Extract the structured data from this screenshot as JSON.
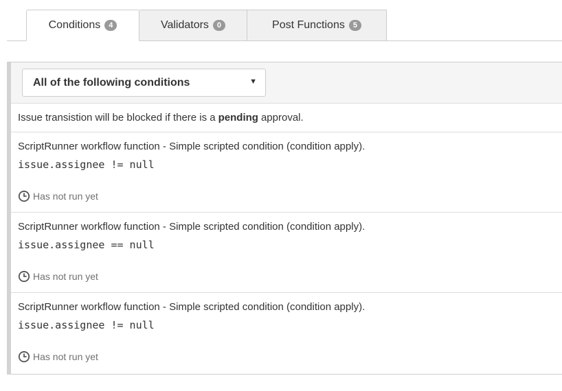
{
  "tabs": [
    {
      "label": "Conditions",
      "count": "4"
    },
    {
      "label": "Validators",
      "count": "0"
    },
    {
      "label": "Post Functions",
      "count": "5"
    }
  ],
  "select": {
    "value": "All of the following conditions",
    "caret": "▼"
  },
  "note": {
    "prefix": "Issue transistion will be blocked if there is a",
    "bold": "pending",
    "suffix": "approval."
  },
  "conditions": [
    {
      "title": "ScriptRunner workflow function - Simple scripted condition (condition apply).",
      "code": "issue.assignee != null",
      "status": "Has not run yet"
    },
    {
      "title": "ScriptRunner workflow function - Simple scripted condition (condition apply).",
      "code": "issue.assignee == null",
      "status": "Has not run yet"
    },
    {
      "title": "ScriptRunner workflow function - Simple scripted condition (condition apply).",
      "code": "issue.assignee != null",
      "status": "Has not run yet"
    }
  ],
  "colors": {
    "badge": "#999999",
    "panel_border": "#d3d3d3",
    "status_text": "#707070"
  },
  "icons": {
    "status": "clock-icon"
  }
}
